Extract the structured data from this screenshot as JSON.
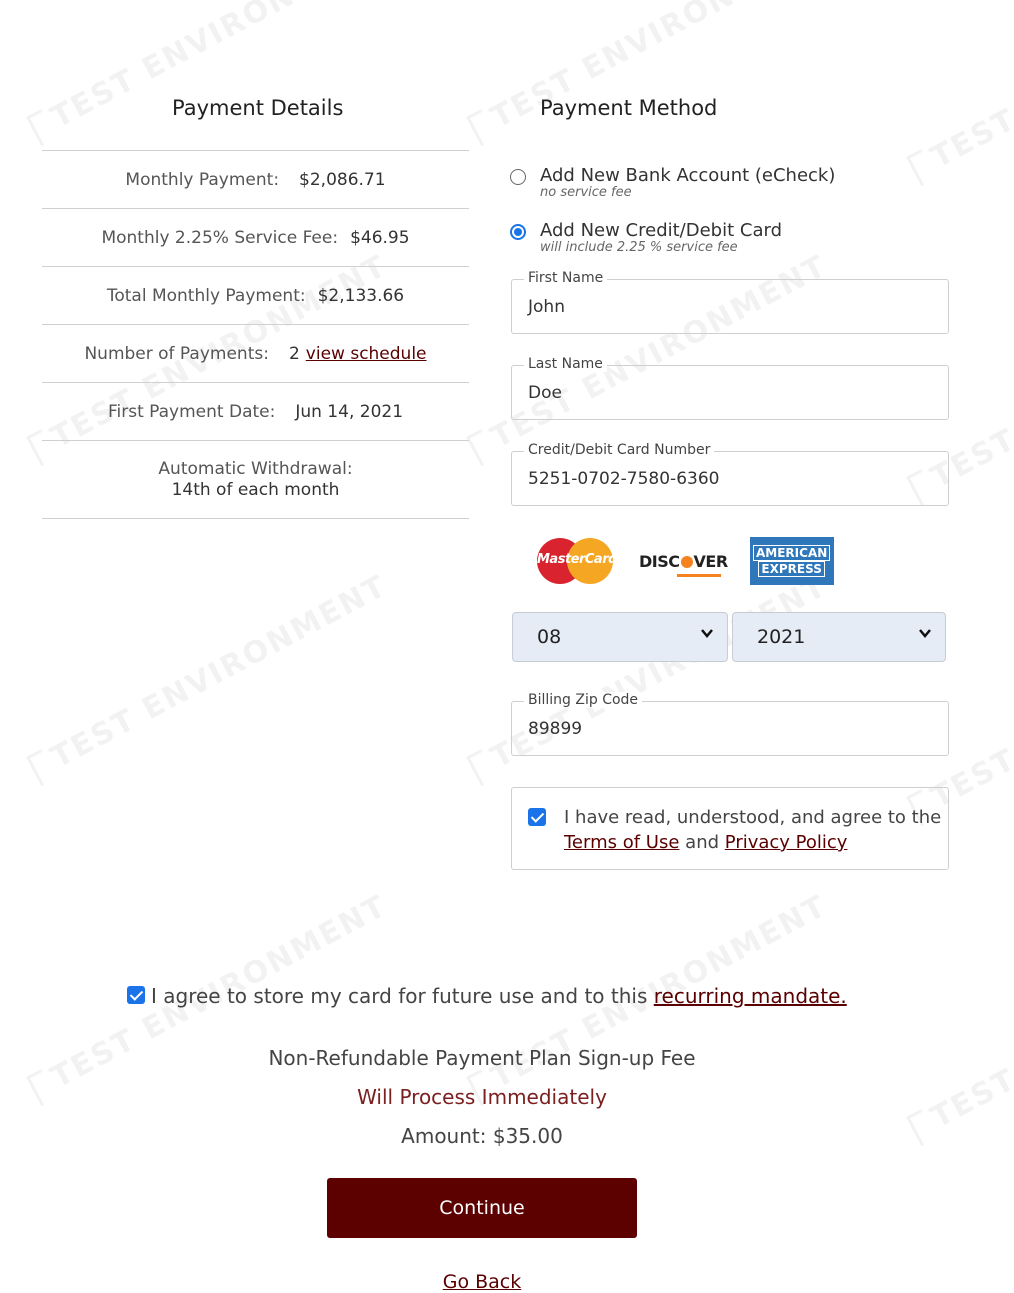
{
  "watermark": "TEST ENVIRONMENT",
  "details": {
    "title": "Payment Details",
    "rows": [
      {
        "label": "Monthly Payment:",
        "value": "$2,086.71"
      },
      {
        "label": "Monthly 2.25% Service Fee:",
        "value": "$46.95"
      },
      {
        "label": "Total Monthly Payment:",
        "value": "$2,133.66"
      },
      {
        "label": "Number of Payments:",
        "value": "2",
        "link": "view schedule"
      },
      {
        "label": "First Payment Date:",
        "value": "Jun 14, 2021"
      },
      {
        "label": "Automatic Withdrawal:",
        "value": "14th of each month"
      }
    ]
  },
  "method": {
    "title": "Payment Method",
    "options": [
      {
        "label": "Add New Bank Account (eCheck)",
        "sub": "no service fee",
        "selected": false
      },
      {
        "label": "Add New Credit/Debit Card",
        "sub": "will include 2.25 % service fee",
        "selected": true
      }
    ],
    "fields": {
      "first_name": {
        "label": "First Name",
        "value": "John"
      },
      "last_name": {
        "label": "Last Name",
        "value": "Doe"
      },
      "card_number": {
        "label": "Credit/Debit Card Number",
        "value": "5251-0702-7580-6360"
      },
      "zip": {
        "label": "Billing Zip Code",
        "value": "89899"
      }
    },
    "card_logos": {
      "mastercard": "MasterCard",
      "discover_a": "DISC",
      "discover_b": "VER",
      "amex_1": "AMERICAN",
      "amex_2": "EXPRESS"
    },
    "expiry": {
      "month": "08",
      "year": "2021"
    },
    "agree": {
      "text": "I have read, understood, and agree to the",
      "terms": "Terms of Use",
      "and": "and",
      "privacy": "Privacy Policy",
      "checked": true
    }
  },
  "store": {
    "text": "I agree to store my card for future use and to this",
    "link": "recurring mandate.",
    "checked": true
  },
  "fee": {
    "title": "Non-Refundable Payment Plan Sign-up Fee",
    "process": "Will Process Immediately",
    "amount": "Amount: $35.00"
  },
  "actions": {
    "continue": "Continue",
    "go_back": "Go Back"
  },
  "colors": {
    "brand": "#5c0000",
    "accent": "#1a73e8"
  }
}
